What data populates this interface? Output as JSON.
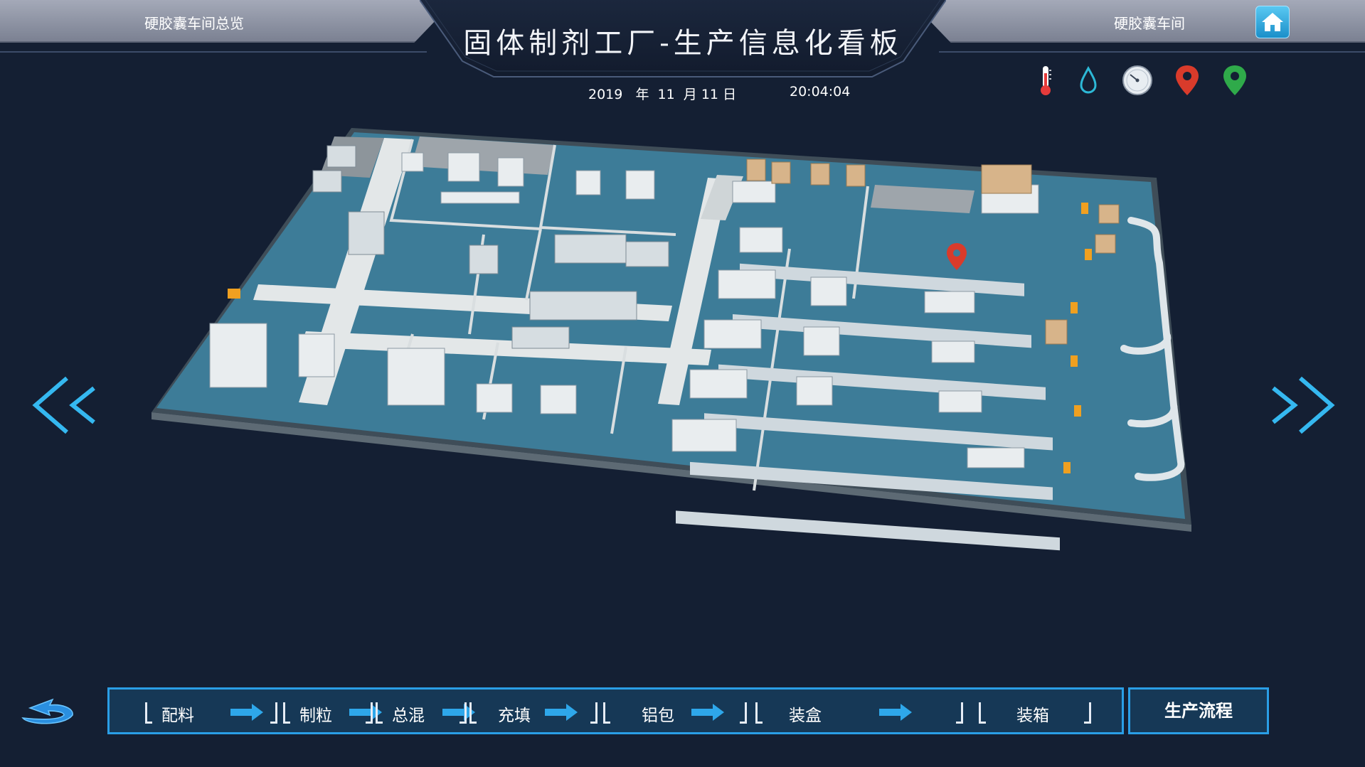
{
  "header": {
    "left_label": "硬胶囊车间总览",
    "title": "固体制剂工厂-生产信息化看板",
    "right_label": "硬胶囊车间",
    "date": "2019   年  11  月 11 日",
    "time": "20:04:04"
  },
  "status_icons": [
    {
      "name": "thermometer-icon",
      "color": "#e53b3b"
    },
    {
      "name": "water-drop-icon",
      "color": "#2db8d6"
    },
    {
      "name": "pressure-gauge-icon",
      "color": "#cfd6df"
    },
    {
      "name": "location-pin-icon",
      "color": "#d93b2b"
    },
    {
      "name": "location-pin-icon",
      "color": "#2faa4a"
    }
  ],
  "colors": {
    "background": "#141f33",
    "accent": "#2a9ee6",
    "floor": "#3d7c98",
    "corridor": "#e3e7e8"
  },
  "process_steps": [
    "配料",
    "制粒",
    "总混",
    "充填",
    "铝包",
    "装盒",
    "装箱"
  ],
  "flow_button_label": "生产流程"
}
